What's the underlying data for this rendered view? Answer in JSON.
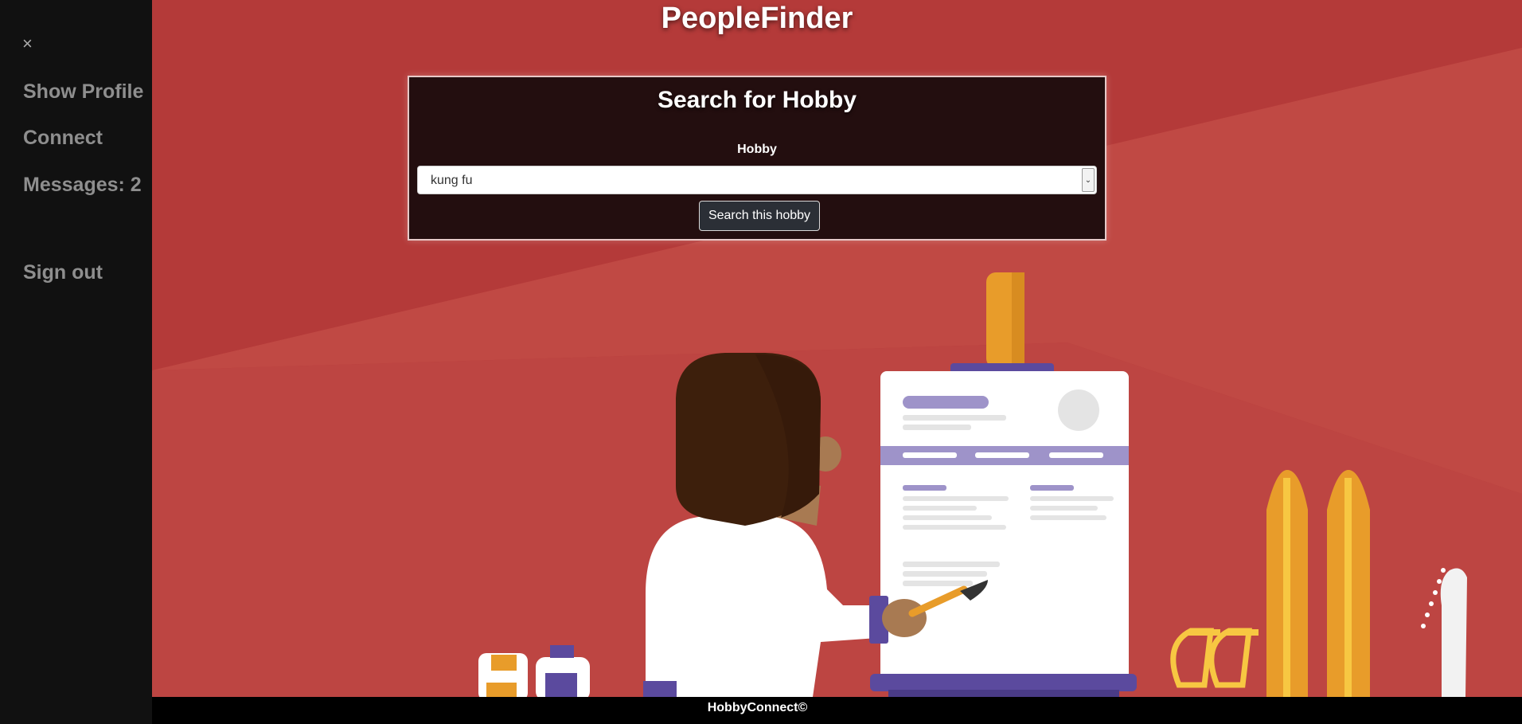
{
  "sidebar": {
    "close_label": "×",
    "items": [
      {
        "label": "Show Profile"
      },
      {
        "label": "Connect"
      },
      {
        "label": "Messages: 2"
      },
      {
        "label": "Sign out"
      }
    ]
  },
  "app": {
    "title": "PeopleFinder"
  },
  "search": {
    "heading": "Search for Hobby",
    "field_label": "Hobby",
    "selected_value": "kung fu",
    "button_label": "Search this hobby"
  },
  "footer": {
    "text": "HobbyConnect©"
  },
  "colors": {
    "background_red": "#b93c3a",
    "sidebar": "#111111",
    "panel": "#230e0f",
    "accent_orange": "#e89c2a",
    "accent_purple": "#5b4a9e"
  }
}
